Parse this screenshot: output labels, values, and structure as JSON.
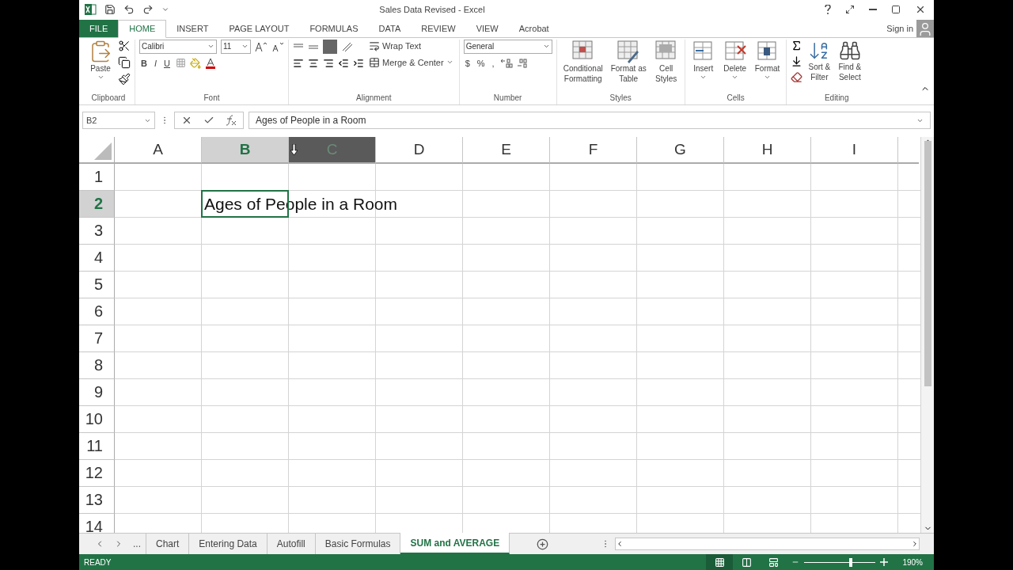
{
  "window": {
    "title": "Sales Data Revised - Excel"
  },
  "account": {
    "sign_in": "Sign in"
  },
  "tabs": [
    {
      "label": "FILE",
      "kind": "file",
      "selected": false
    },
    {
      "label": "HOME",
      "kind": "tab",
      "selected": true
    },
    {
      "label": "INSERT",
      "kind": "tab",
      "selected": false
    },
    {
      "label": "PAGE LAYOUT",
      "kind": "tab",
      "selected": false
    },
    {
      "label": "FORMULAS",
      "kind": "tab",
      "selected": false
    },
    {
      "label": "DATA",
      "kind": "tab",
      "selected": false
    },
    {
      "label": "REVIEW",
      "kind": "tab",
      "selected": false
    },
    {
      "label": "VIEW",
      "kind": "tab",
      "selected": false
    },
    {
      "label": "Acrobat",
      "kind": "tab",
      "selected": false
    }
  ],
  "ribbon": {
    "clipboard": {
      "label": "Clipboard",
      "paste": "Paste"
    },
    "font": {
      "label": "Font",
      "font_name": "Calibri",
      "font_size": "11",
      "bold": "B",
      "italic": "I",
      "underline": "U"
    },
    "alignment": {
      "label": "Alignment",
      "wrap_text": "Wrap Text",
      "merge": "Merge & Center"
    },
    "number": {
      "label": "Number",
      "format": "General",
      "currency": "$",
      "percent": "%",
      "comma": ","
    },
    "styles": {
      "label": "Styles",
      "buttons": [
        {
          "lines": [
            "Conditional",
            "Formatting"
          ]
        },
        {
          "lines": [
            "Format as",
            "Table"
          ]
        },
        {
          "lines": [
            "Cell",
            "Styles"
          ]
        }
      ]
    },
    "cells": {
      "label": "Cells",
      "buttons": [
        {
          "lines": [
            "Insert"
          ]
        },
        {
          "lines": [
            "Delete"
          ]
        },
        {
          "lines": [
            "Format"
          ]
        }
      ]
    },
    "editing": {
      "label": "Editing",
      "buttons": [
        {
          "lines": [
            "Sort &",
            "Filter"
          ]
        },
        {
          "lines": [
            "Find &",
            "Select"
          ]
        }
      ]
    }
  },
  "formula_bar": {
    "name_box": "B2",
    "formula": "Ages of People in a Room"
  },
  "columns": [
    {
      "label": "A",
      "selected": false,
      "hovered": false
    },
    {
      "label": "B",
      "selected": true,
      "hovered": false
    },
    {
      "label": "C",
      "selected": false,
      "hovered": true
    },
    {
      "label": "D",
      "selected": false,
      "hovered": false
    },
    {
      "label": "E",
      "selected": false,
      "hovered": false
    },
    {
      "label": "F",
      "selected": false,
      "hovered": false
    },
    {
      "label": "G",
      "selected": false,
      "hovered": false
    },
    {
      "label": "H",
      "selected": false,
      "hovered": false
    },
    {
      "label": "I",
      "selected": false,
      "hovered": false
    }
  ],
  "rows": [
    {
      "label": "1",
      "selected": false
    },
    {
      "label": "2",
      "selected": true,
      "cells": [
        {
          "active": false
        },
        {
          "text": "Ages of People in a Room",
          "active": true
        }
      ]
    },
    {
      "label": "3",
      "selected": false
    },
    {
      "label": "4",
      "selected": false
    },
    {
      "label": "5",
      "selected": false
    },
    {
      "label": "6",
      "selected": false
    },
    {
      "label": "7",
      "selected": false
    },
    {
      "label": "8",
      "selected": false
    },
    {
      "label": "9",
      "selected": false
    },
    {
      "label": "10",
      "selected": false
    },
    {
      "label": "11",
      "selected": false
    },
    {
      "label": "12",
      "selected": false
    },
    {
      "label": "13",
      "selected": false
    },
    {
      "label": "14",
      "selected": false
    }
  ],
  "sheet_tabs": {
    "overflow": "...",
    "tabs": [
      {
        "label": "Chart",
        "selected": false
      },
      {
        "label": "Entering Data",
        "selected": false
      },
      {
        "label": "Autofill",
        "selected": false
      },
      {
        "label": "Basic Formulas",
        "selected": false
      },
      {
        "label": "SUM and AVERAGE",
        "selected": true
      }
    ]
  },
  "status_bar": {
    "status": "READY",
    "views": [
      {
        "kind": "normal",
        "selected": true
      },
      {
        "kind": "page_layout",
        "selected": false
      },
      {
        "kind": "page_break",
        "selected": false
      }
    ],
    "zoom": {
      "level": 0.65,
      "reading": "190%"
    }
  }
}
